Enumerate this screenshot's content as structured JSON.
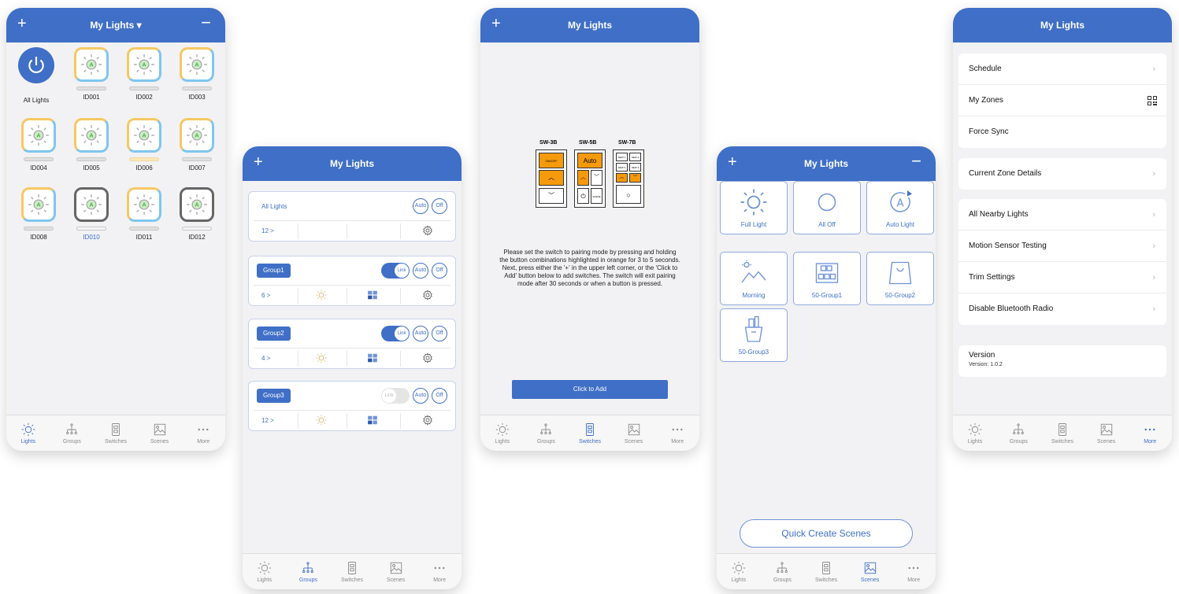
{
  "colors": {
    "accent": "#3f6fc6",
    "orange": "#f59a0c"
  },
  "tabs": [
    "Lights",
    "Groups",
    "Switches",
    "Scenes",
    "More"
  ],
  "s1": {
    "title": "My Lights",
    "lights": [
      {
        "label": "All Lights"
      },
      {
        "label": "ID001"
      },
      {
        "label": "ID002"
      },
      {
        "label": "ID003"
      },
      {
        "label": "ID004"
      },
      {
        "label": "ID005"
      },
      {
        "label": "ID006"
      },
      {
        "label": "ID007"
      },
      {
        "label": "ID008"
      },
      {
        "label": "ID010"
      },
      {
        "label": "ID011"
      },
      {
        "label": "ID012"
      }
    ],
    "bulb_letter": "A"
  },
  "s2": {
    "title": "My Lights",
    "all_lights": {
      "label": "All Lights",
      "count": "12 >",
      "auto": "Auto",
      "off": "Off"
    },
    "groups": [
      {
        "name": "Group1",
        "count": "6 >",
        "link": "Link",
        "auto": "Auto",
        "off": "Off",
        "linked": true
      },
      {
        "name": "Group2",
        "count": "4 >",
        "link": "Link",
        "auto": "Auto",
        "off": "Off",
        "linked": true
      },
      {
        "name": "Group3",
        "count": "12 >",
        "link": "Link",
        "auto": "Auto",
        "off": "Off",
        "linked": false
      }
    ]
  },
  "s3": {
    "title": "My Lights",
    "switch_models": [
      "SW-3B",
      "SW-5B",
      "SW-7B"
    ],
    "sw3_top": "ON/OFF",
    "sw5_top": "Auto",
    "sw5_bottom": "SCENE",
    "sw7_keys": [
      "NEW 1",
      "NEW 2",
      "NEW 3",
      "NEW 4"
    ],
    "instructions": "Please set the switch to pairing mode by pressing and holding the button combinations highlighted in orange for 3 to 5 seconds. Next, press either the '+' in the upper left corner, or the 'Click to Add' button below to add switches. The switch will exit pairing mode after 30 seconds or when a button is pressed.",
    "add_button": "Click to Add"
  },
  "s4": {
    "title": "My Lights",
    "scenes": [
      "Full Light",
      "All Off",
      "Auto Light",
      "Morning",
      "50-Group1",
      "50-Group2",
      "50-Group3"
    ],
    "auto_letter": "A",
    "quick_create": "Quick Create Scenes"
  },
  "s5": {
    "title": "My Lights",
    "group1": [
      "Schedule",
      "My Zones",
      "Force Sync"
    ],
    "group2": [
      "Current Zone Details"
    ],
    "group3": [
      "All Nearby Lights",
      "Motion Sensor Testing",
      "Trim Settings",
      "Disable Bluetooth Radio"
    ],
    "version_title": "Version",
    "version_value": "Version: 1.0.2"
  }
}
